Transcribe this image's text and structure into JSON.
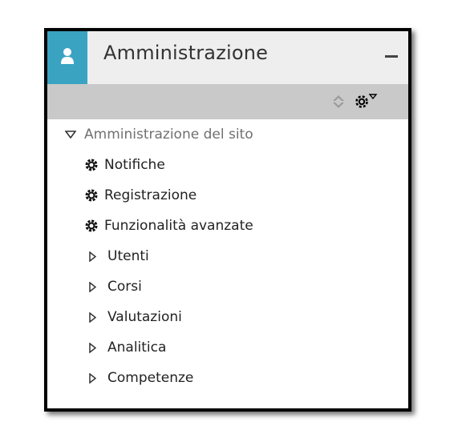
{
  "block": {
    "title": "Amministrazione",
    "header_accent": "#3aa3c2",
    "header_bg": "#eeeeee",
    "toolbar_bg": "#c9c9c9"
  },
  "tree": {
    "root": {
      "label": "Amministrazione del sito",
      "expanded": true
    },
    "settings": [
      {
        "label": "Notifiche",
        "icon": "gear-icon"
      },
      {
        "label": "Registrazione",
        "icon": "gear-icon"
      },
      {
        "label": "Funzionalità avanzate",
        "icon": "gear-icon"
      }
    ],
    "categories": [
      {
        "label": "Utenti",
        "icon": "triangle-right-icon"
      },
      {
        "label": "Corsi",
        "icon": "triangle-right-icon"
      },
      {
        "label": "Valutazioni",
        "icon": "triangle-right-icon"
      },
      {
        "label": "Analitica",
        "icon": "triangle-right-icon"
      },
      {
        "label": "Competenze",
        "icon": "triangle-right-icon"
      }
    ]
  }
}
